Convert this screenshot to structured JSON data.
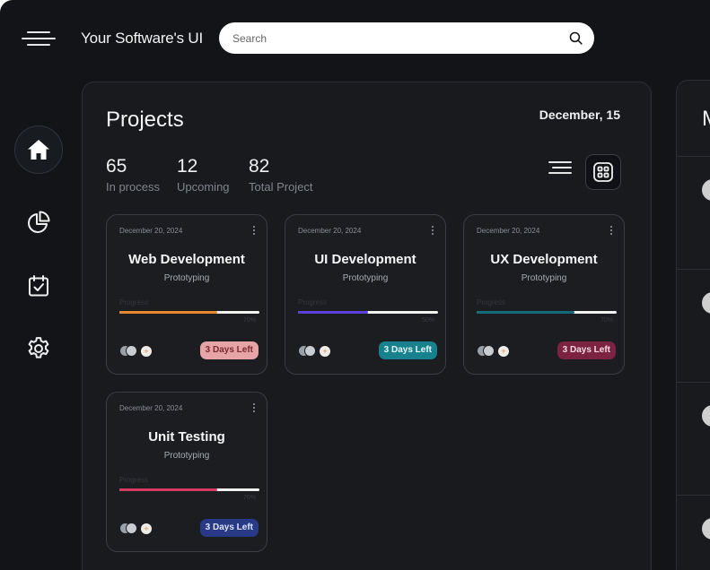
{
  "app": {
    "title": "Your Software's UI"
  },
  "search": {
    "placeholder": "Search",
    "value": ""
  },
  "sidebar": {
    "items": [
      {
        "icon": "home-icon",
        "active": true
      },
      {
        "icon": "pie-chart-icon",
        "active": false
      },
      {
        "icon": "calendar-check-icon",
        "active": false
      },
      {
        "icon": "gear-icon",
        "active": false
      }
    ]
  },
  "projects": {
    "title": "Projects",
    "date": "December, 15",
    "stats": [
      {
        "value": "65",
        "label": "In process"
      },
      {
        "value": "12",
        "label": "Upcoming"
      },
      {
        "value": "82",
        "label": "Total Project"
      }
    ],
    "cards": [
      {
        "date": "December 20, 2024",
        "title": "Web Development",
        "subtitle": "Prototyping",
        "progress_label": "Progress",
        "progress": 0.7,
        "progress_text": "70%",
        "bar_color": "#e8892e",
        "days_left": "3 Days Left",
        "badge_bg": "#e6a4a6",
        "badge_fg": "#7a2a32"
      },
      {
        "date": "December 20, 2024",
        "title": "UI Development",
        "subtitle": "Prototyping",
        "progress_label": "Progress",
        "progress": 0.5,
        "progress_text": "50%",
        "bar_color": "#5b3fd6",
        "days_left": "3 Days Left",
        "badge_bg": "#17828d",
        "badge_fg": "#e6f7f8"
      },
      {
        "date": "December 20, 2024",
        "title": "UX Development",
        "subtitle": "Prototyping",
        "progress_label": "Progress",
        "progress": 0.7,
        "progress_text": "70%",
        "bar_color": "#146b7a",
        "days_left": "3 Days Left",
        "badge_bg": "#7b2340",
        "badge_fg": "#f6dbe2"
      },
      {
        "date": "December 20, 2024",
        "title": "Unit Testing",
        "subtitle": "Prototyping",
        "progress_label": "Progress",
        "progress": 0.7,
        "progress_text": "70%",
        "bar_color": "#d63a5e",
        "days_left": "3 Days Left",
        "badge_bg": "#283a86",
        "badge_fg": "#dde3ff"
      }
    ]
  },
  "right_panel": {
    "title_fragment": "M"
  },
  "colors": {
    "background": "#121418",
    "panel": "#181a1e",
    "card": "#1b1d21"
  }
}
